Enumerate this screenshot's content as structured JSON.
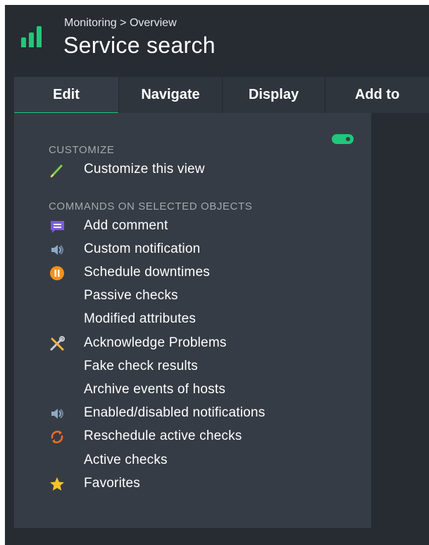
{
  "header": {
    "breadcrumb": "Monitoring > Overview",
    "title": "Service search",
    "logo_icon": "bar-chart-logo-icon"
  },
  "tabs": [
    {
      "label": "Edit",
      "active": true
    },
    {
      "label": "Navigate",
      "active": false
    },
    {
      "label": "Display",
      "active": false
    },
    {
      "label": "Add to",
      "active": false
    }
  ],
  "menu": {
    "toggle_state": "on",
    "sections": {
      "customize": "CUSTOMIZE",
      "commands": "COMMANDS ON SELECTED OBJECTS"
    },
    "items": [
      {
        "label": "Customize this view",
        "icon": "pencil-icon"
      },
      {
        "label": "Add comment",
        "icon": "comment-icon"
      },
      {
        "label": "Custom notification",
        "icon": "speaker-icon"
      },
      {
        "label": "Schedule downtimes",
        "icon": "pause-icon"
      },
      {
        "label": "Passive checks",
        "icon": ""
      },
      {
        "label": "Modified attributes",
        "icon": ""
      },
      {
        "label": "Acknowledge Problems",
        "icon": "tools-icon"
      },
      {
        "label": "Fake check results",
        "icon": ""
      },
      {
        "label": "Archive events of hosts",
        "icon": ""
      },
      {
        "label": "Enabled/disabled notifications",
        "icon": "speaker-icon"
      },
      {
        "label": "Reschedule active checks",
        "icon": "reload-icon"
      },
      {
        "label": "Active checks",
        "icon": ""
      },
      {
        "label": "Favorites",
        "icon": "star-icon"
      }
    ]
  },
  "colors": {
    "accent": "#1ec87a",
    "background": "#272b32",
    "panel": "#363c45",
    "tab_bar": "#2f353d",
    "comment_icon": "#7b5ce0",
    "pause_icon": "#f5901e",
    "reload_icon": "#ee6a2e",
    "star_icon": "#f7c325",
    "pencil_icon": "#7ccf4a",
    "speaker_icon": "#8fa8c4"
  }
}
